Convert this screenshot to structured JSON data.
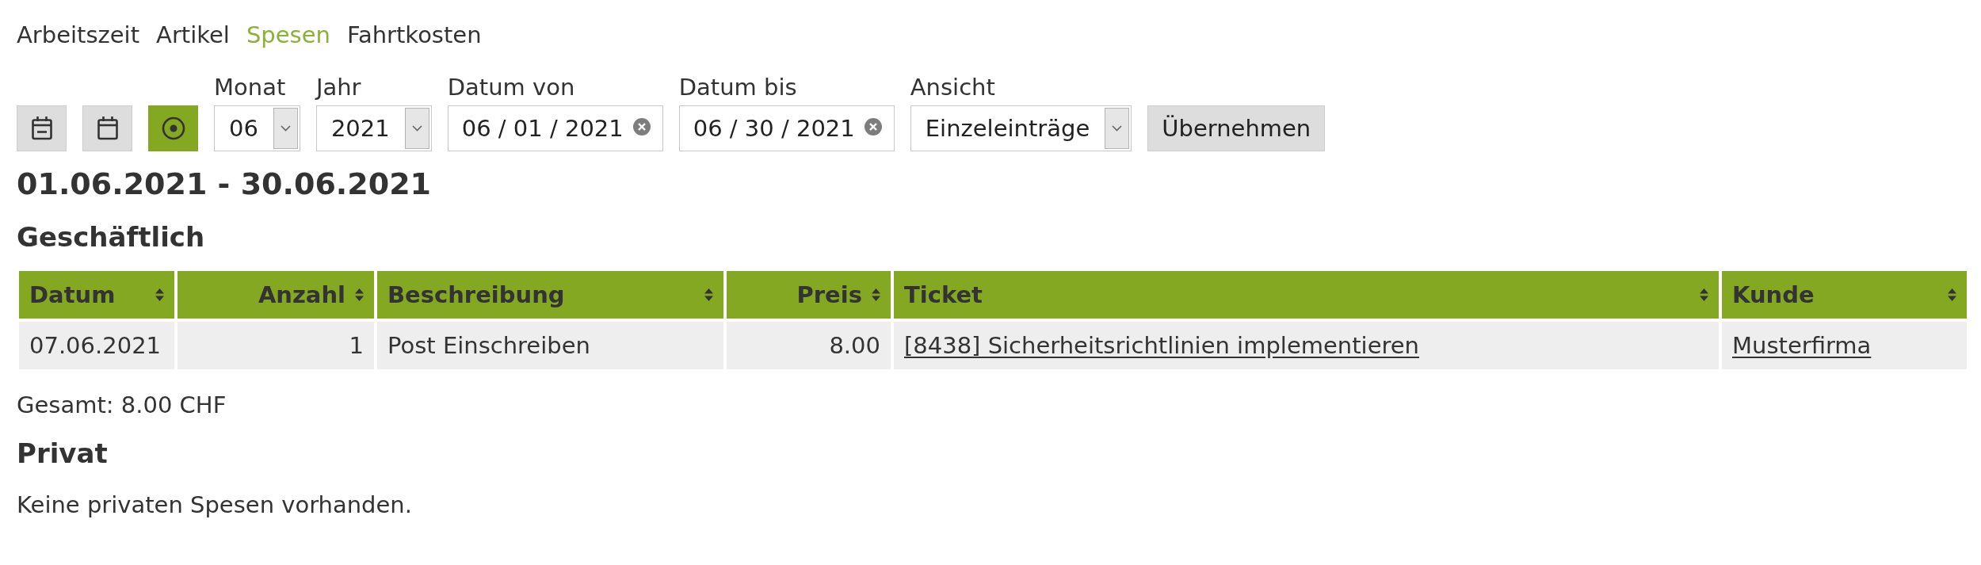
{
  "nav_tabs": [
    {
      "label": "Arbeitszeit",
      "selected": false
    },
    {
      "label": "Artikel",
      "selected": false
    },
    {
      "label": "Spesen",
      "selected": true
    },
    {
      "label": "Fahrtkosten",
      "selected": false
    }
  ],
  "period_buttons": [
    {
      "kind": "minus",
      "selected": false
    },
    {
      "kind": "calendar",
      "selected": false
    },
    {
      "kind": "dot",
      "selected": true
    }
  ],
  "filters": [
    {
      "kind": "select",
      "label": "Monat",
      "value": "06"
    },
    {
      "kind": "select",
      "label": "Jahr",
      "value": "2021"
    },
    {
      "kind": "date",
      "label": "Datum von",
      "value": "06 / 01 / 2021"
    },
    {
      "kind": "date",
      "label": "Datum bis",
      "value": "06 / 30 / 2021"
    },
    {
      "kind": "select",
      "label": "Ansicht",
      "value": "Einzeleinträge"
    }
  ],
  "apply_button": "Übernehmen",
  "period_title": "01.06.2021 - 30.06.2021",
  "sections": [
    {
      "title": "Geschäftlich",
      "table": {
        "columns": [
          {
            "label": "Datum",
            "kind": "text"
          },
          {
            "label": "Anzahl",
            "kind": "number"
          },
          {
            "label": "Beschreibung",
            "kind": "text"
          },
          {
            "label": "Preis",
            "kind": "number"
          },
          {
            "label": "Ticket",
            "kind": "link"
          },
          {
            "label": "Kunde",
            "kind": "link"
          }
        ],
        "rows": [
          [
            "07.06.2021",
            "1",
            "Post Einschreiben",
            "8.00",
            "[8438] Sicherheitsrichtlinien implementieren",
            "Musterfirma"
          ]
        ]
      },
      "total": "Gesamt: 8.00 CHF"
    },
    {
      "title": "Privat",
      "empty_text": "Keine privaten Spesen vorhanden."
    }
  ]
}
